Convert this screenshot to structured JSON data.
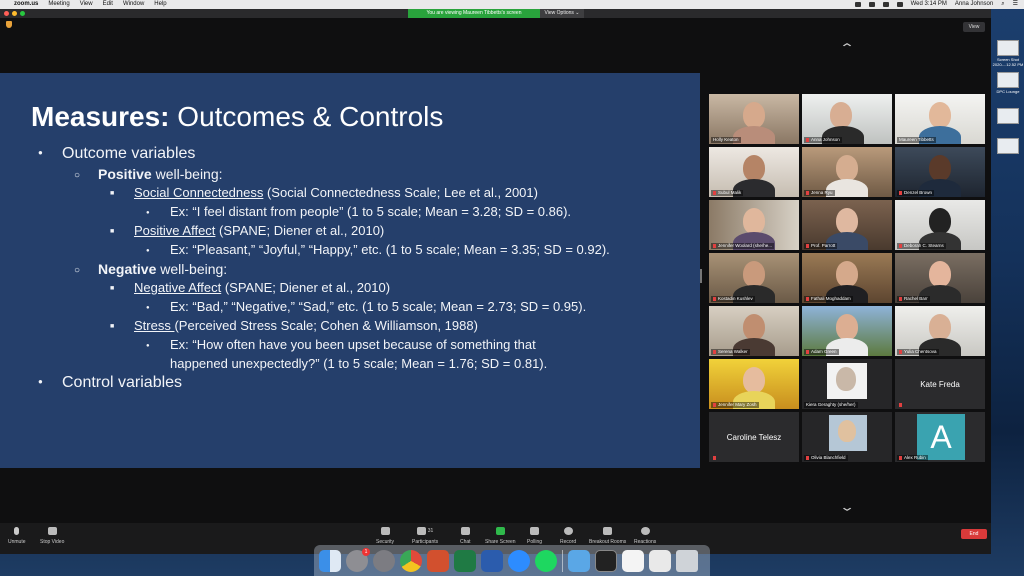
{
  "menubar": {
    "app_name": "zoom.us",
    "items": [
      "Meeting",
      "View",
      "Edit",
      "Window",
      "Help"
    ],
    "clock": "Wed 3:14 PM",
    "user": "Anna Johnson"
  },
  "banner": {
    "viewing_text": "You are viewing Maureen Tibbetts's screen",
    "view_options": "View Options ⌄"
  },
  "view_button": "View",
  "slide": {
    "title_bold": "Measures:",
    "title_rest": " Outcomes & Controls",
    "lines": {
      "outcome": "Outcome variables",
      "positive_bold": "Positive",
      "positive_rest": " well-being:",
      "social_u": "Social Connectedness",
      "social_rest": " (Social Connectedness Scale; Lee et al., 2001)",
      "social_ex": "Ex: “I feel distant from people” (1 to 5 scale; Mean = 3.28; SD = 0.86).",
      "posaff_u": "Positive Affect",
      "posaff_rest": " (SPANE; Diener et al., 2010)",
      "posaff_ex": "Ex: “Pleasant,” “Joyful,” “Happy,” etc. (1 to 5 scale; Mean = 3.35; SD = 0.92).",
      "negative_bold": "Negative",
      "negative_rest": " well-being:",
      "negaff_u": "Negative Affect",
      "negaff_rest": " (SPANE; Diener et al., 2010)",
      "negaff_ex": "Ex: “Bad,” “Negative,” “Sad,” etc. (1 to 5 scale; Mean = 2.73; SD = 0.95).",
      "stress_u": "Stress ",
      "stress_rest": "(Perceived Stress Scale; Cohen & Williamson, 1988)",
      "stress_ex1": "Ex: “How often have you been upset because of something that",
      "stress_ex2": "happened unexpectedly?” (1 to 5 scale; Mean = 1.76; SD = 0.81).",
      "control": "Control variables"
    }
  },
  "participants": [
    {
      "name": "Holly Keaton"
    },
    {
      "name": "Anna Johnson"
    },
    {
      "name": "Maureen Tibbetts"
    },
    {
      "name": "Subul Malik"
    },
    {
      "name": "Jenna Ryu"
    },
    {
      "name": "Denzel Brown"
    },
    {
      "name": "Jennifer Woolard (she/he..."
    },
    {
      "name": "Prof. Parrott"
    },
    {
      "name": "Deborah C. Stearns"
    },
    {
      "name": "Kostadin Kushlev"
    },
    {
      "name": "Fathali Moghaddam"
    },
    {
      "name": "Rachel Barr"
    },
    {
      "name": "Serena Walker"
    },
    {
      "name": "Adam Green"
    },
    {
      "name": "Yulia Chentsova"
    },
    {
      "name": "Jennifer Mary Zosh"
    },
    {
      "name": "Kiera Geraghty (she/her)"
    },
    {
      "name": "Kate Freda"
    },
    {
      "name": "Caroline Telesz"
    },
    {
      "name": "Olivia Blanchfield"
    },
    {
      "name": "Alex Rubin"
    }
  ],
  "avatar_letter": "A",
  "toolbar": {
    "unmute": "Unmute",
    "stop_video": "Stop Video",
    "security": "Security",
    "participants": "Participants",
    "participants_count": "31",
    "chat": "Chat",
    "share_screen": "Share Screen",
    "polling": "Polling",
    "record": "Record",
    "breakout": "Breakout Rooms",
    "reactions": "Reactions",
    "end": "End"
  },
  "desktop": {
    "item1": "Screen Shot 2020-...12.52 PM",
    "item2": "DPC Lounge"
  },
  "dock_badge": "1",
  "colors": {
    "slide_bg": "#253f6b",
    "banner_green": "#29a33c",
    "active_speaker": "#e7e95b",
    "end_red": "#d93a3a"
  }
}
